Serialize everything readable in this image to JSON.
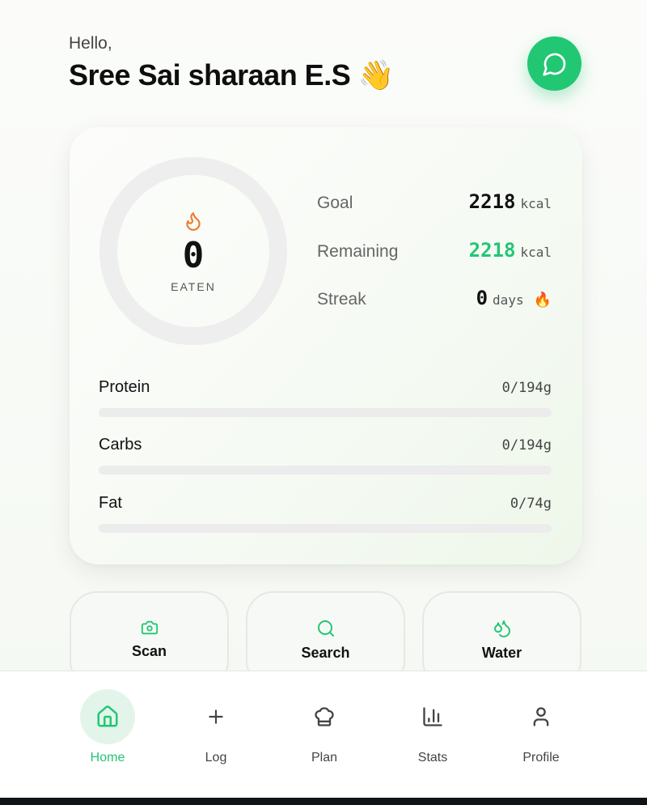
{
  "greeting": {
    "hello": "Hello,",
    "name": "Sree Sai sharaan E.S 👋"
  },
  "colors": {
    "accent": "#22c774",
    "flame": "#f07a2a",
    "remaining": "#22c774"
  },
  "summary": {
    "eaten_value": "0",
    "eaten_label": "EATEN",
    "eaten_progress": 0,
    "goal_label": "Goal",
    "goal_value": "2218",
    "goal_unit": "kcal",
    "remaining_label": "Remaining",
    "remaining_value": "2218",
    "remaining_unit": "kcal",
    "streak_label": "Streak",
    "streak_value": "0",
    "streak_unit": "days",
    "streak_icon": "🔥"
  },
  "macros": [
    {
      "name": "Protein",
      "value": "0/194g",
      "progress": 0
    },
    {
      "name": "Carbs",
      "value": "0/194g",
      "progress": 0
    },
    {
      "name": "Fat",
      "value": "0/74g",
      "progress": 0
    }
  ],
  "actions": [
    {
      "label": "Scan",
      "icon": "camera-icon"
    },
    {
      "label": "Search",
      "icon": "search-icon"
    },
    {
      "label": "Water",
      "icon": "water-drops-icon"
    }
  ],
  "nav": [
    {
      "label": "Home",
      "icon": "home-icon",
      "active": true
    },
    {
      "label": "Log",
      "icon": "plus-icon",
      "active": false
    },
    {
      "label": "Plan",
      "icon": "chef-hat-icon",
      "active": false
    },
    {
      "label": "Stats",
      "icon": "bar-chart-icon",
      "active": false
    },
    {
      "label": "Profile",
      "icon": "user-icon",
      "active": false
    }
  ]
}
